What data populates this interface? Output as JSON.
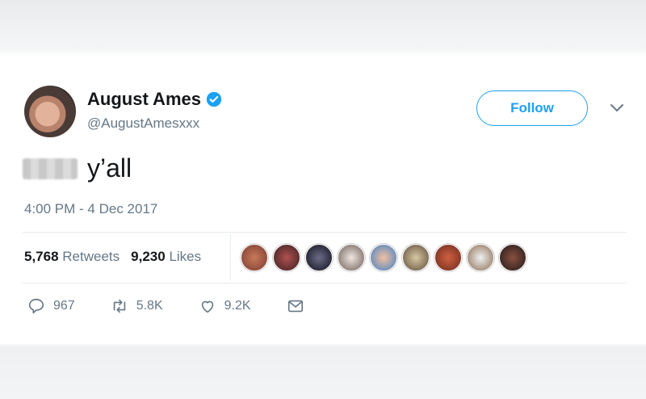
{
  "tweet": {
    "author": {
      "name": "August Ames",
      "handle": "@AugustAmesxxx"
    },
    "follow_label": "Follow",
    "text": "y’all",
    "timestamp": "4:00 PM - 4 Dec 2017",
    "stats": {
      "retweets_count": "5,768",
      "retweets_label": "Retweets",
      "likes_count": "9,230",
      "likes_label": "Likes"
    },
    "actions": {
      "replies": "967",
      "retweets": "5.8K",
      "likes": "9.2K"
    }
  },
  "colors": {
    "accent": "#1da1f2",
    "secondary_text": "#657786",
    "primary_text": "#14171a"
  },
  "icons": [
    "verified-badge-icon",
    "chevron-down-icon",
    "reply-icon",
    "retweet-icon",
    "like-icon",
    "message-icon"
  ]
}
